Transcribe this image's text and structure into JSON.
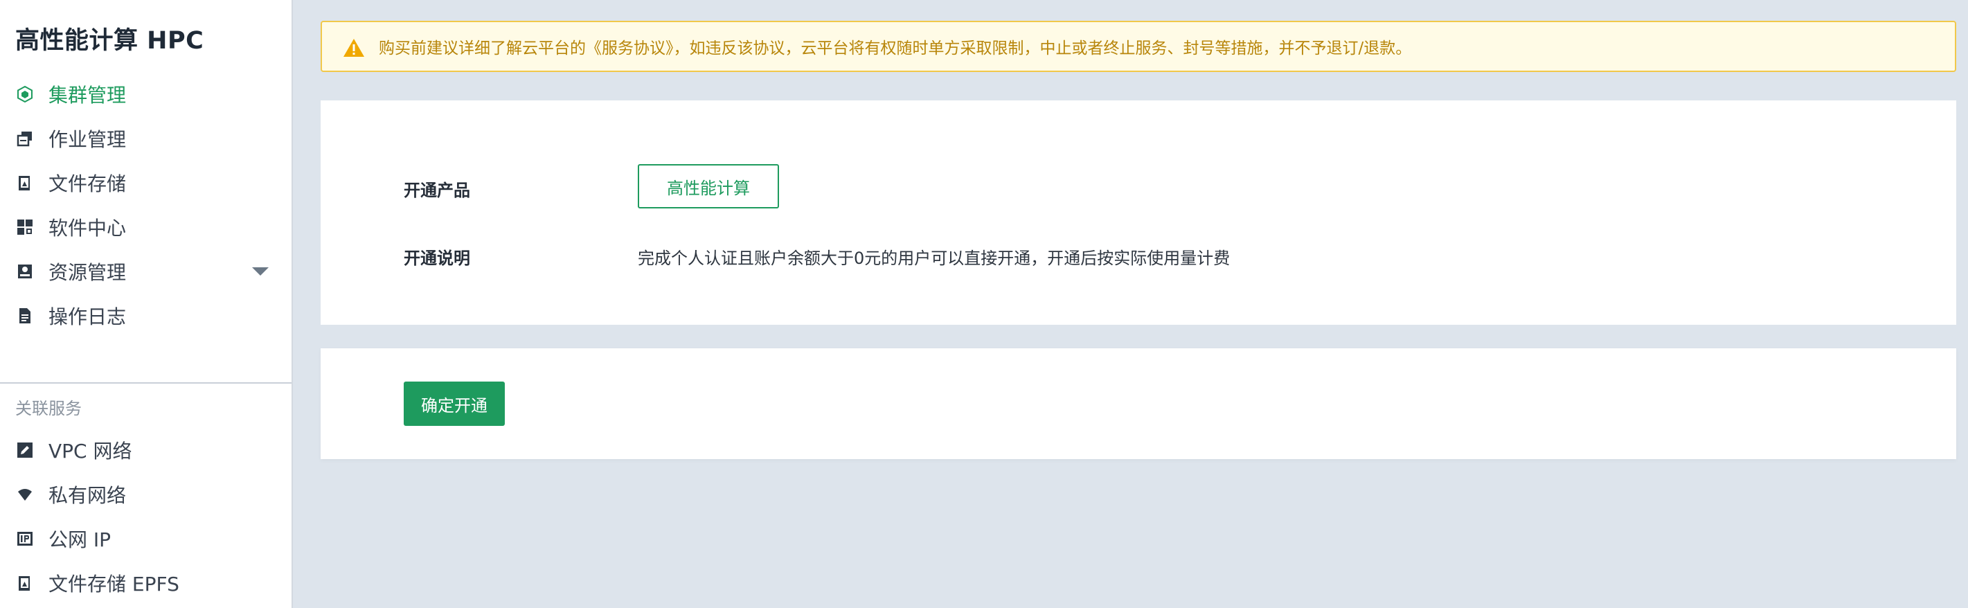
{
  "sidebar": {
    "title": "高性能计算 HPC",
    "items": [
      {
        "label": "集群管理",
        "icon": "cluster-icon",
        "active": true
      },
      {
        "label": "作业管理",
        "icon": "job-icon"
      },
      {
        "label": "文件存储",
        "icon": "file-storage-icon"
      },
      {
        "label": "软件中心",
        "icon": "grid-icon"
      },
      {
        "label": "资源管理",
        "icon": "resource-icon",
        "expandable": true
      },
      {
        "label": "操作日志",
        "icon": "document-icon"
      }
    ],
    "related_label": "关联服务",
    "related": [
      {
        "label": "VPC 网络",
        "icon": "edit-icon"
      },
      {
        "label": "私有网络",
        "icon": "wifi-icon"
      },
      {
        "label": "公网 IP",
        "icon": "ip-icon"
      },
      {
        "label": "文件存储 EPFS",
        "icon": "file-storage-icon"
      }
    ]
  },
  "notice": {
    "text": "购买前建议详细了解云平台的《服务协议》，如违反该协议，云平台将有权随时单方采取限制，中止或者终止服务、封号等措施，并不予退订/退款。"
  },
  "form": {
    "product_label": "开通产品",
    "product_value": "高性能计算",
    "desc_label": "开通说明",
    "desc_value": "完成个人认证且账户余额大于0元的用户可以直接开通，开通后按实际使用量计费"
  },
  "actions": {
    "confirm_label": "确定开通"
  },
  "colors": {
    "accent": "#1e9b5e",
    "warning_bg": "#fffbe6",
    "warning_border": "#f1c84a",
    "warning_text": "#b8860b",
    "page_bg": "#dde4ec"
  }
}
